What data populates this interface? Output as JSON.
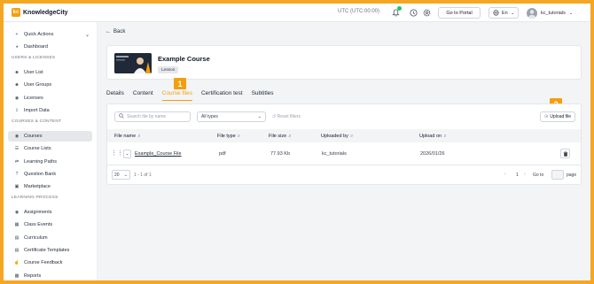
{
  "app": {
    "logo_mark": "kc",
    "name": "KnowledgeCity"
  },
  "topbar": {
    "timezone": "UTC (UTC:00:00)",
    "go_to_portal": "Go to Portal",
    "language": "En",
    "username": "kc_tutorials",
    "accent_color": "#f59e0b"
  },
  "sidebar": {
    "quick_actions": "Quick Actions",
    "dashboard": "Dashboard",
    "sections": {
      "users": "USERS & LICENSES",
      "courses": "COURSES & CONTENT",
      "learning": "LEARNING PROCESS"
    },
    "items": {
      "user_list": "User List",
      "user_groups": "User Groups",
      "licenses": "Licenses",
      "import_data": "Import Data",
      "courses": "Courses",
      "course_lists": "Course Lists",
      "learning_paths": "Learning Paths",
      "question_bank": "Question Bank",
      "marketplace": "Marketplace",
      "assignments": "Assignments",
      "class_events": "Class Events",
      "curriculum": "Curriculum",
      "certificate_templates": "Certificate Templates",
      "course_feedback": "Course Feedback",
      "reports": "Reports"
    }
  },
  "main": {
    "back": "Back",
    "course": {
      "title": "Example Course",
      "badge": "Lesson"
    },
    "tabs": [
      "Details",
      "Content",
      "Course files",
      "Certification test",
      "Subtitles"
    ],
    "active_tab": "Course files",
    "markers": [
      "1",
      "2"
    ]
  },
  "files": {
    "search_placeholder": "Search file by name",
    "types_value": "All types",
    "reset_filters": "Reset filters",
    "upload": "Upload file",
    "columns": [
      "File name",
      "File type",
      "File size",
      "Uploaded by",
      "Upload on"
    ],
    "rows": [
      {
        "name": "Example_Course File",
        "type": "pdf",
        "size": "77.93 Kb",
        "uploaded_by": "kc_tutorials",
        "uploaded_on": "2026/01/26"
      }
    ],
    "pager": {
      "per_page": "20",
      "range": "1 - 1 of 1",
      "current_page": "1",
      "go_to": "Go to",
      "page_word": "page"
    }
  }
}
